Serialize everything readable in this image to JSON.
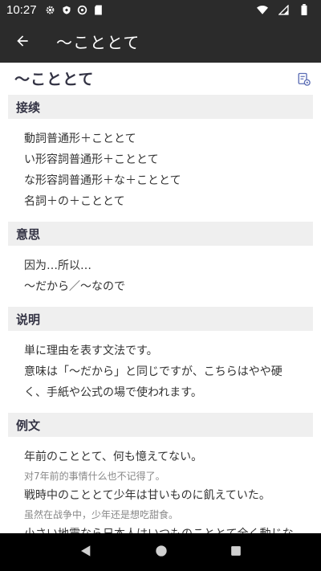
{
  "status": {
    "time": "10:27"
  },
  "app_bar": {
    "title": "〜こととて"
  },
  "entry": {
    "heading": "〜こととて",
    "sections": [
      {
        "header": "接续",
        "lines": [
          "動詞普通形＋こととて",
          "い形容詞普通形＋こととて",
          "な形容詞普通形＋な＋こととて",
          "名詞＋の＋こととて"
        ]
      },
      {
        "header": "意思",
        "lines": [
          "因为…所以…",
          "〜だから／〜なので"
        ]
      },
      {
        "header": "说明",
        "lines": [
          "単に理由を表す文法です。",
          "意味は「〜だから」と同じですが、こちらはやや硬",
          "く、手紙や公式の場で使われます。"
        ]
      },
      {
        "header": "例文",
        "examples": [
          {
            "jp": "年前のこととて、何も憶えてない。",
            "cn": "对7年前的事情什么也不记得了。"
          },
          {
            "jp": "戦時中のこととて少年は甘いものに飢えていた。",
            "cn": "虽然在战争中，少年还是想吃甜食。"
          },
          {
            "jp": "小さい地震なら日本人はいつものこととて全く動じな",
            "cn": ""
          }
        ]
      }
    ]
  }
}
